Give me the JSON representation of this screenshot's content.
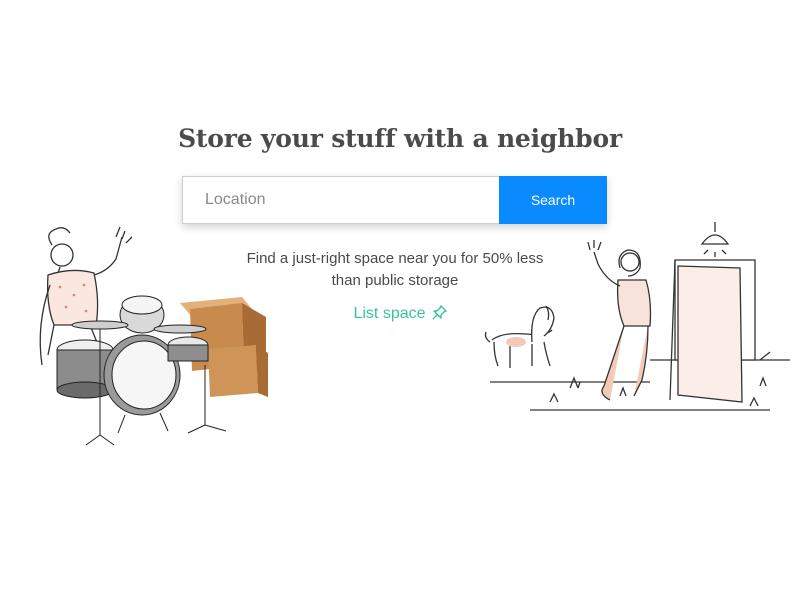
{
  "hero": {
    "headline": "Store your stuff with a neighbor",
    "tagline": "Find a just-right space near you for 50% less than public storage"
  },
  "search": {
    "placeholder": "Location",
    "value": "",
    "button_label": "Search"
  },
  "list_link": {
    "label": "List space",
    "icon": "pushpin-icon"
  },
  "colors": {
    "primary_button": "#0a8aff",
    "link_accent": "#39c39a",
    "heading": "#4b4b4b"
  },
  "illustrations": {
    "left": "person-with-drum-kit-and-boxes",
    "right": "person-waving-at-doorway-with-dog"
  }
}
